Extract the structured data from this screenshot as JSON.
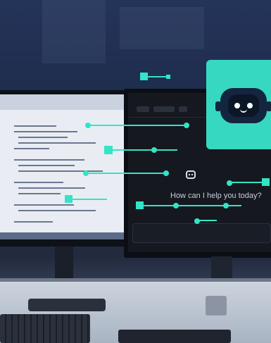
{
  "chat": {
    "prompt": "How can I help you today?"
  },
  "colors": {
    "accent": "#35e3c6",
    "card": "#37d8c1",
    "background": "#1b2b4c"
  },
  "icons": [
    "chatbot-icon",
    "robot-icon"
  ]
}
